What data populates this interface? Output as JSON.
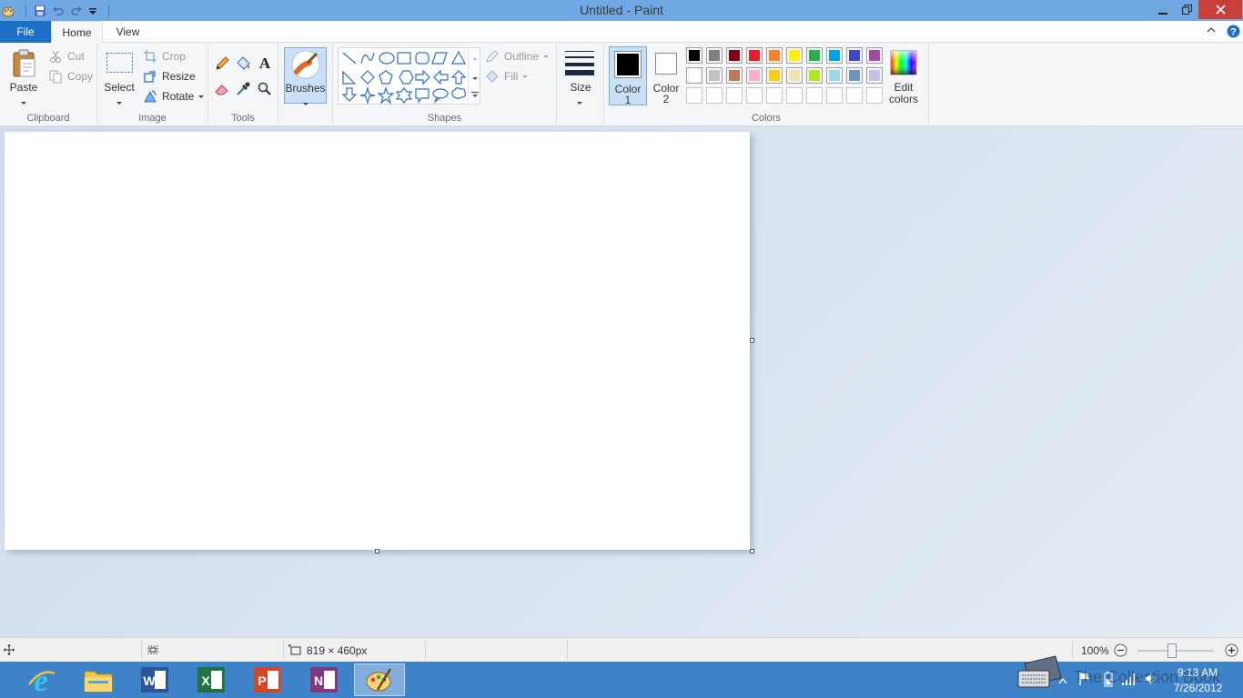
{
  "window": {
    "title": "Untitled - Paint"
  },
  "tabs": {
    "file": "File",
    "home": "Home",
    "view": "View"
  },
  "clipboard": {
    "paste": "Paste",
    "cut": "Cut",
    "copy": "Copy",
    "label": "Clipboard"
  },
  "image": {
    "select": "Select",
    "crop": "Crop",
    "resize": "Resize",
    "rotate": "Rotate",
    "label": "Image"
  },
  "tools": {
    "label": "Tools",
    "brushes": "Brushes"
  },
  "shapes": {
    "outline": "Outline",
    "fill": "Fill",
    "label": "Shapes"
  },
  "size": {
    "label": "Size"
  },
  "colors": {
    "color1_line1": "Color",
    "color1_line2": "1",
    "color2_line1": "Color",
    "color2_line2": "2",
    "edit_line1": "Edit",
    "edit_line2": "colors",
    "label": "Colors",
    "palette_row1": [
      "#000000",
      "#7f7f7f",
      "#880015",
      "#ed1c24",
      "#ff7f27",
      "#fff200",
      "#22b14c",
      "#00a2e8",
      "#3f48cc",
      "#a349a4"
    ],
    "palette_row2": [
      "#ffffff",
      "#c3c3c3",
      "#b97a57",
      "#ffaec9",
      "#ffc90e",
      "#efe4b0",
      "#b5e61d",
      "#99d9ea",
      "#7092be",
      "#c8bfe7"
    ]
  },
  "status": {
    "canvas_size": "819 × 460px",
    "zoom": "100%",
    "zoom_level": 1.0
  },
  "tray": {
    "time": "9:13 AM",
    "date": "7/26/2012",
    "watermark": "The Collection Book"
  }
}
